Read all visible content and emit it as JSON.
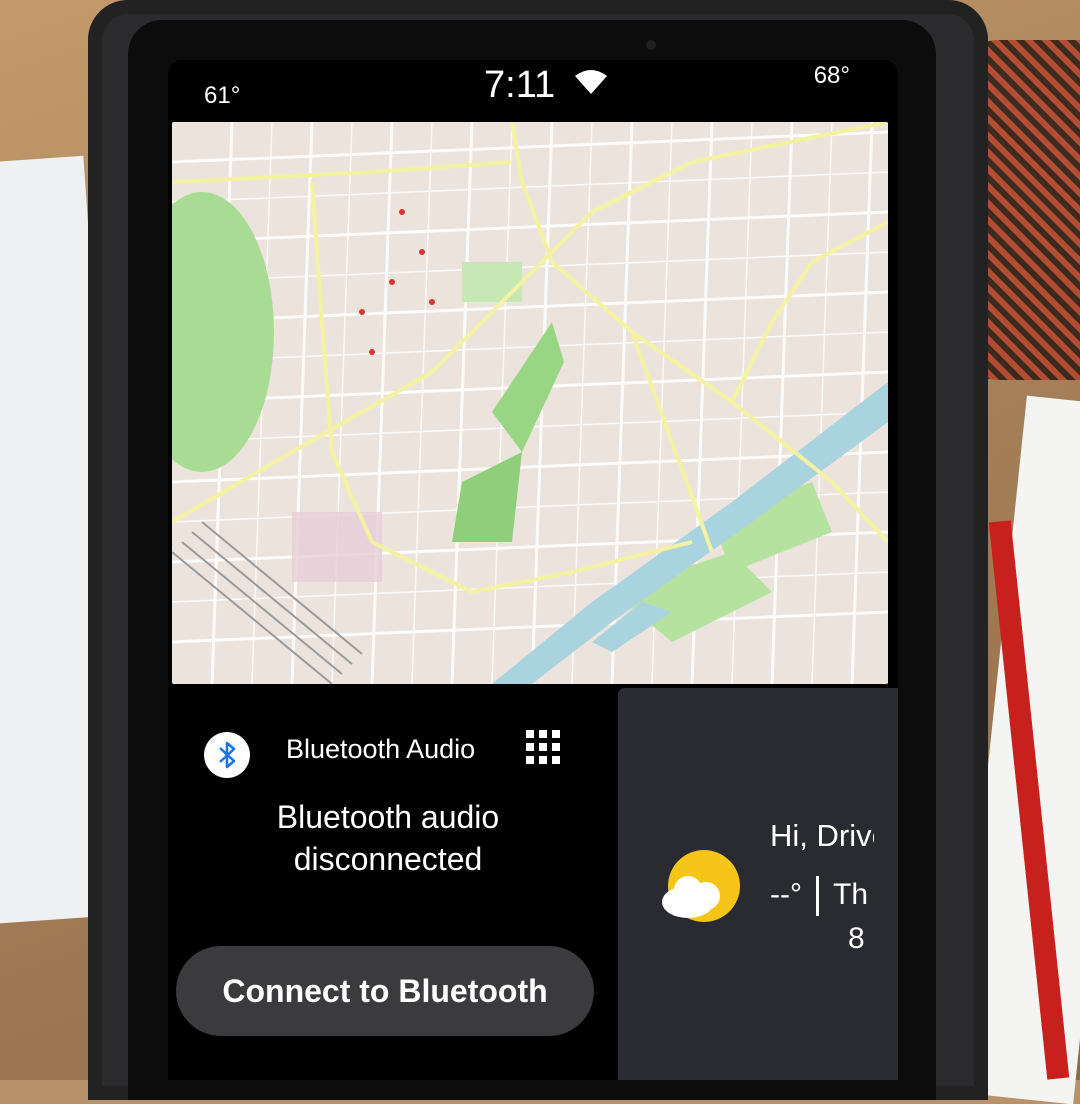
{
  "status_bar": {
    "temp_left": "61°",
    "time": "7:11",
    "temp_right": "68°"
  },
  "map": {
    "zoom_out_label": "−",
    "zoom_in_label": "+"
  },
  "bluetooth": {
    "title": "Bluetooth Audio",
    "status": "Bluetooth audio disconnected",
    "connect_label": "Connect to Bluetooth"
  },
  "weather": {
    "greeting": "Hi, Driver",
    "temp": "--°",
    "day": "Th",
    "date": "8"
  },
  "colors": {
    "card_background": "#2a2a31",
    "button_background": "#3b3b3e",
    "bluetooth_blue": "#1a73e8",
    "sun_yellow": "#f5c518"
  },
  "icons": [
    "wifi-icon",
    "bluetooth-icon",
    "grid-icon",
    "partly-cloudy-icon"
  ]
}
